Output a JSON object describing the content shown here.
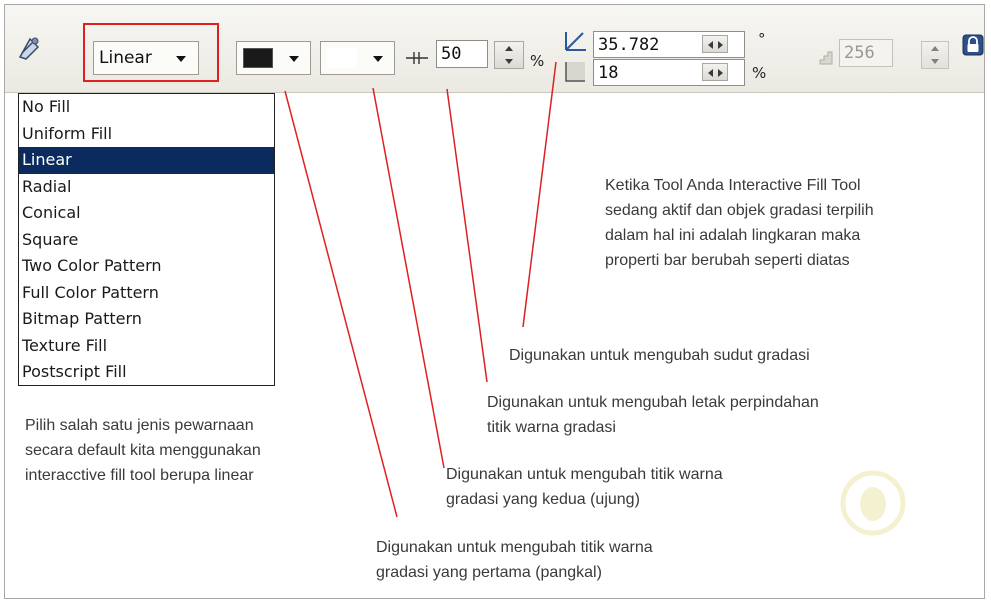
{
  "toolbar": {
    "fill_type_value": "Linear",
    "edge_pad_value": "50",
    "edge_pad_unit": "%",
    "angle_value": "35.782",
    "angle_unit": "°",
    "offset_value": "18",
    "offset_unit": "%",
    "steps_value": "256"
  },
  "fill_type_options": [
    "No Fill",
    "Uniform Fill",
    "Linear",
    "Radial",
    "Conical",
    "Square",
    "Two Color Pattern",
    "Full Color Pattern",
    "Bitmap Pattern",
    "Texture Fill",
    "Postscript Fill"
  ],
  "selected_option": "Linear",
  "colors": {
    "from_color": "#1a1a1a",
    "to_color": "#ffffff",
    "selected_bg": "#0b2a5e",
    "highlight_border": "#e02020",
    "annotation_line": "#e02020"
  },
  "icons": {
    "tool": "interactive-fill-icon",
    "angle": "angle-icon",
    "offset": "edge-offset-icon",
    "edge_pad": "edge-pad-icon",
    "steps": "steps-icon",
    "lock": "lock-icon"
  },
  "notes": {
    "context": [
      "Ketika Tool Anda Interactive Fill Tool",
      "sedang aktif dan objek gradasi terpilih",
      "dalam hal ini adalah lingkaran maka",
      "properti bar berubah seperti diatas"
    ],
    "angle": [
      "Digunakan untuk mengubah sudut gradasi"
    ],
    "edge_pad": [
      "Digunakan untuk mengubah letak perpindahan",
      "titik warna gradasi"
    ],
    "to_color": [
      "Digunakan untuk mengubah titik warna",
      "gradasi yang kedua (ujung)"
    ],
    "fill_type": [
      "Pilih salah satu jenis pewarnaan",
      "secara default kita menggunakan",
      "interacctive  fill tool berupa linear"
    ],
    "from_color": [
      "Digunakan untuk mengubah titik warna",
      "gradasi yang pertama (pangkal)"
    ]
  }
}
